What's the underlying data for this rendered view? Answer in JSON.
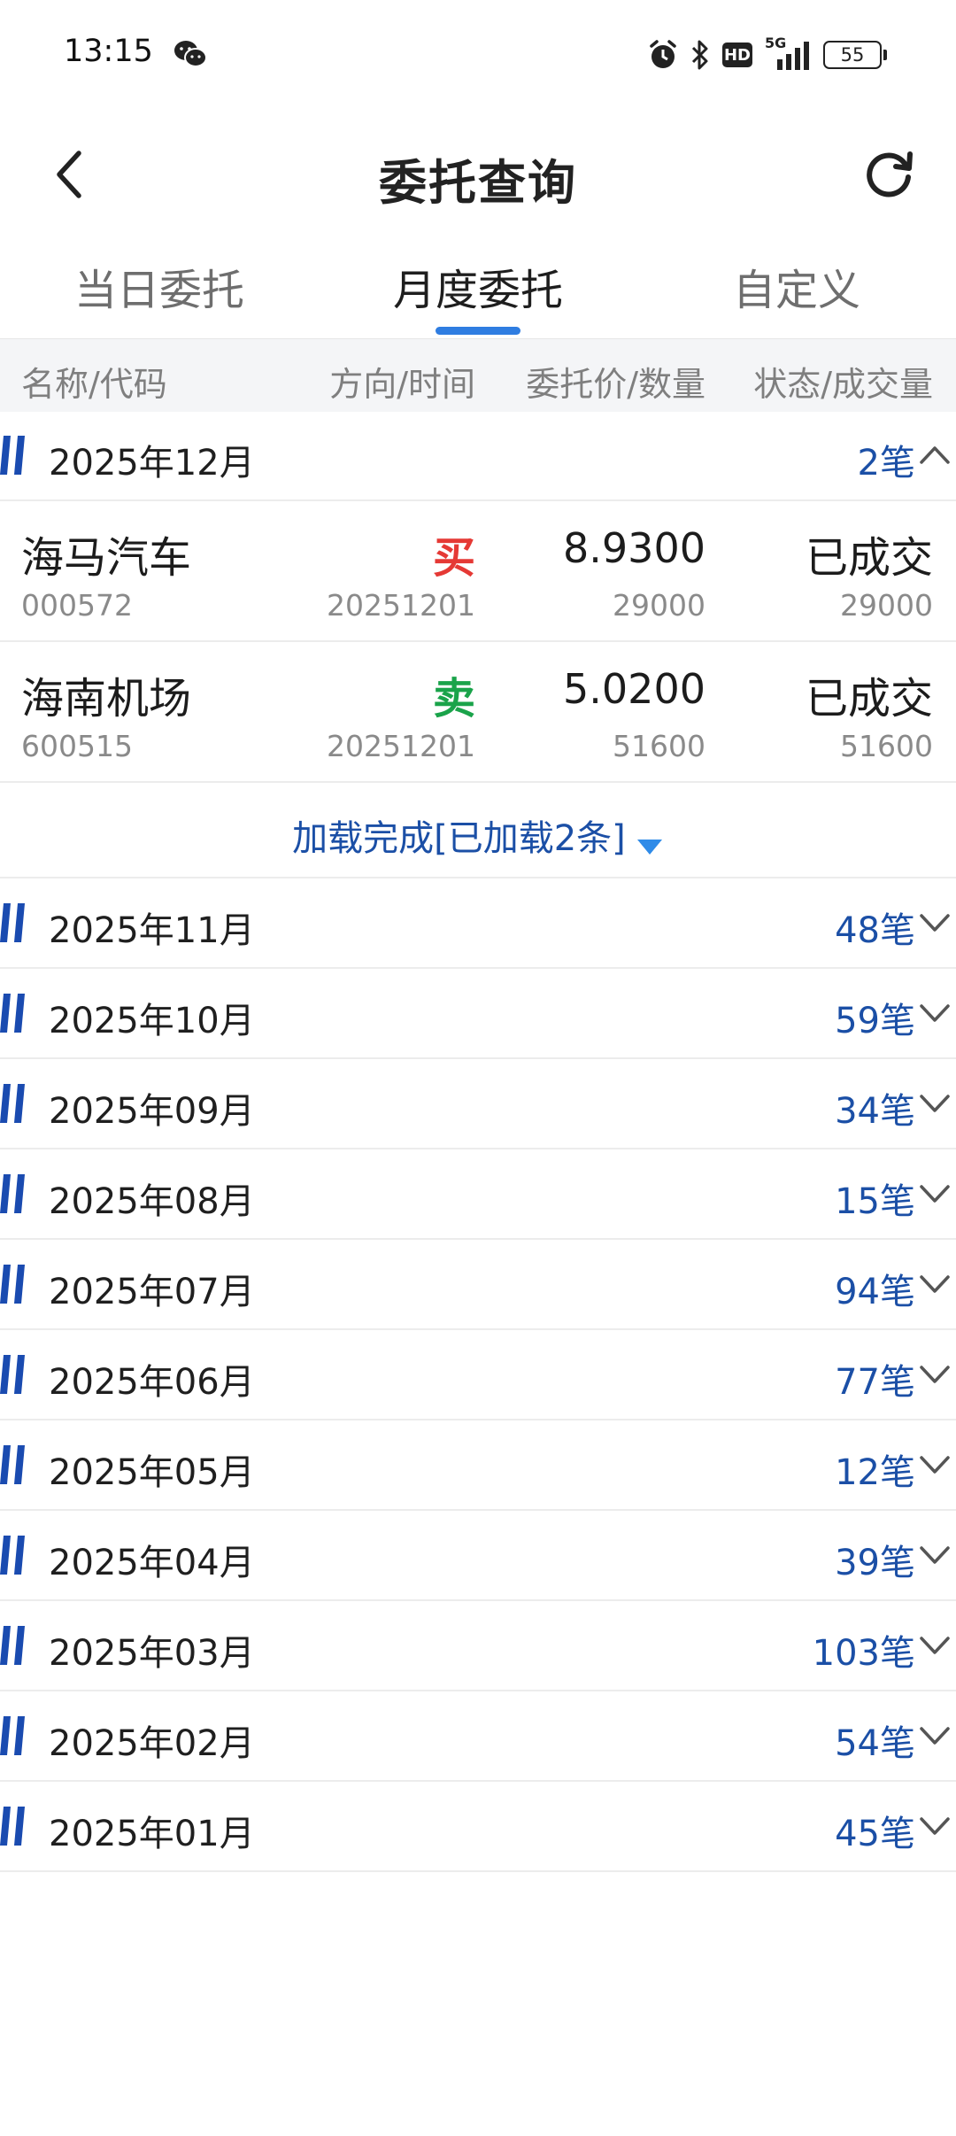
{
  "status_bar": {
    "time": "13:15",
    "network": "5G",
    "hd_label": "HD",
    "battery": "55"
  },
  "header": {
    "title": "委托查询",
    "back_icon": "chevron-left-icon",
    "refresh_icon": "refresh-icon"
  },
  "tabs": [
    {
      "label": "当日委托",
      "active": false
    },
    {
      "label": "月度委托",
      "active": true
    },
    {
      "label": "自定义",
      "active": false
    }
  ],
  "columns": {
    "name": "名称/代码",
    "direction": "方向/时间",
    "price": "委托价/数量",
    "status": "状态/成交量"
  },
  "expanded_group": {
    "month": "2025年12月",
    "count": "2笔",
    "orders": [
      {
        "name": "海马汽车",
        "code": "000572",
        "direction": "买",
        "direction_color": "#e53935",
        "date": "20251201",
        "price": "8.9300",
        "quantity": "29000",
        "status": "已成交",
        "filled": "29000"
      },
      {
        "name": "海南机场",
        "code": "600515",
        "direction": "卖",
        "direction_color": "#1aa34a",
        "date": "20251201",
        "price": "5.0200",
        "quantity": "51600",
        "status": "已成交",
        "filled": "51600"
      }
    ],
    "load_text": "加载完成[已加载2条]"
  },
  "groups": [
    {
      "month": "2025年11月",
      "count": "48笔"
    },
    {
      "month": "2025年10月",
      "count": "59笔"
    },
    {
      "month": "2025年09月",
      "count": "34笔"
    },
    {
      "month": "2025年08月",
      "count": "15笔"
    },
    {
      "month": "2025年07月",
      "count": "94笔"
    },
    {
      "month": "2025年06月",
      "count": "77笔"
    },
    {
      "month": "2025年05月",
      "count": "12笔"
    },
    {
      "month": "2025年04月",
      "count": "39笔"
    },
    {
      "month": "2025年03月",
      "count": "103笔"
    },
    {
      "month": "2025年02月",
      "count": "54笔"
    },
    {
      "month": "2025年01月",
      "count": "45笔"
    }
  ],
  "colors": {
    "accent": "#2f7de1",
    "count_blue": "#1b4fa6",
    "marker_blue": "#1a4bb0",
    "buy_red": "#e53935",
    "sell_green": "#1aa34a"
  }
}
